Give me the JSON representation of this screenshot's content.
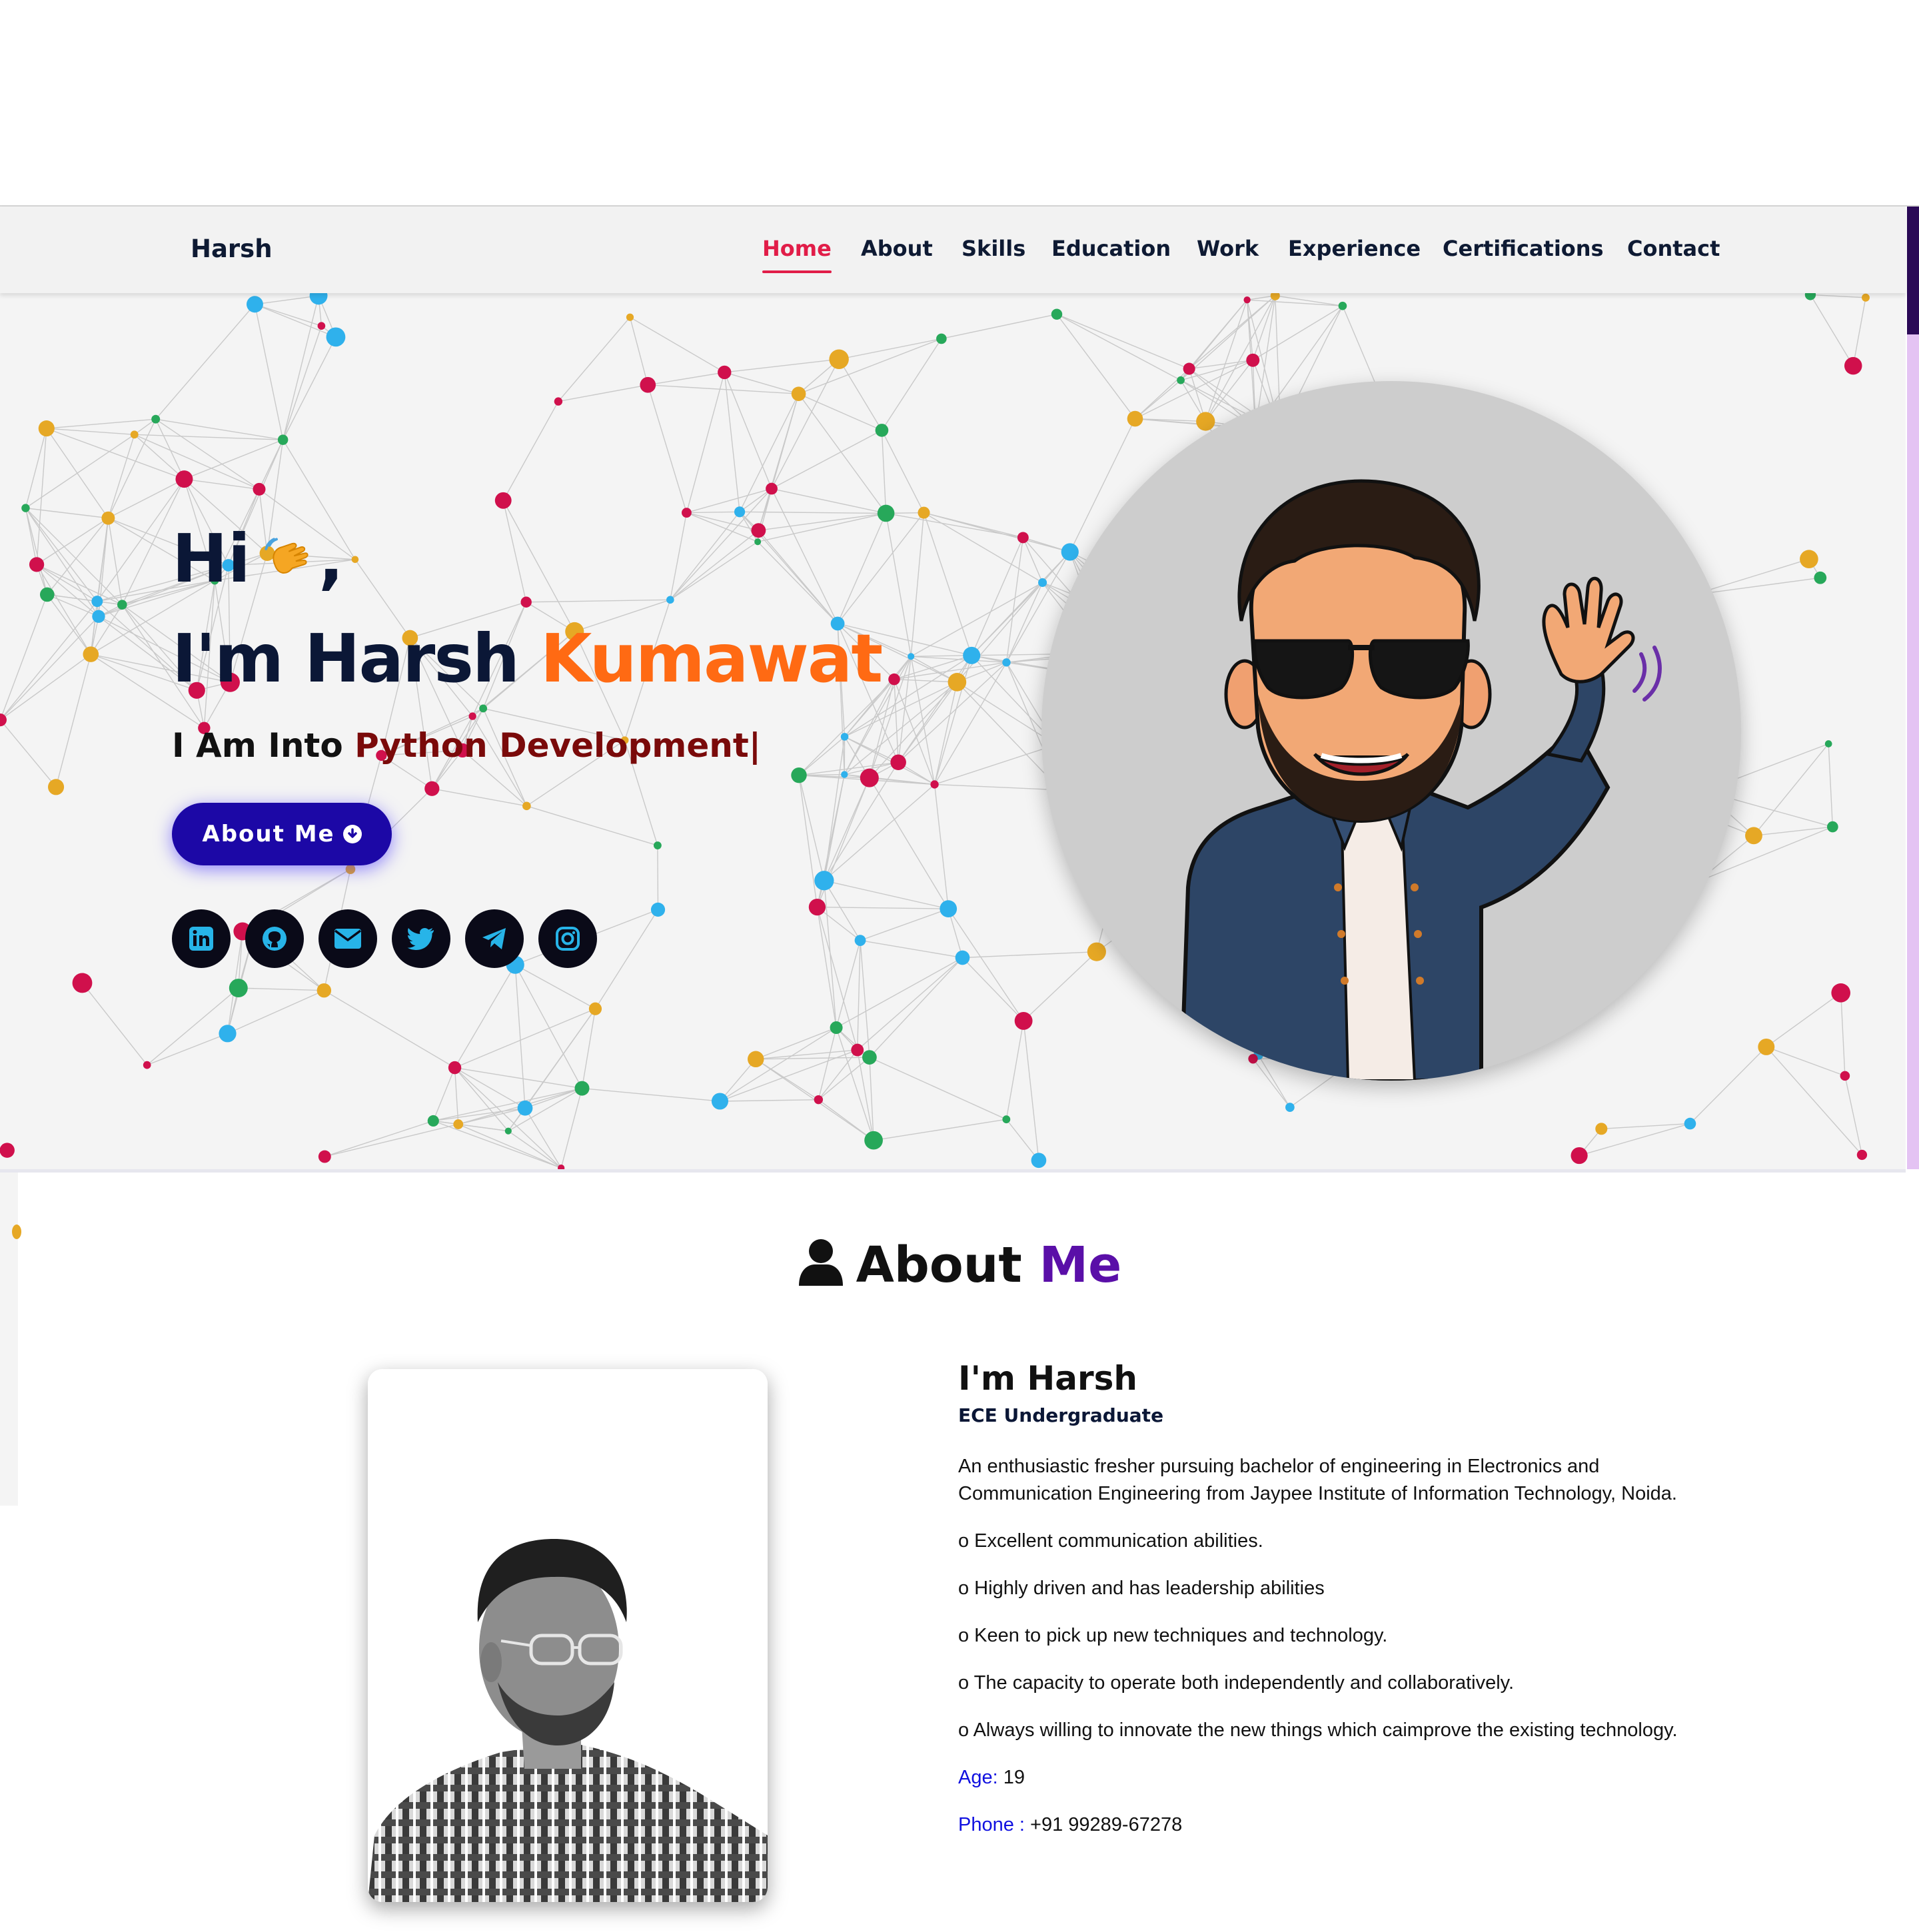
{
  "brand": "Harsh",
  "nav": {
    "items": [
      {
        "label": "Home",
        "active": true
      },
      {
        "label": "About",
        "active": false
      },
      {
        "label": "Skills",
        "active": false
      },
      {
        "label": "Education",
        "active": false
      },
      {
        "label": "Work",
        "active": false
      },
      {
        "label": "Experience",
        "active": false
      },
      {
        "label": "Certifications",
        "active": false
      },
      {
        "label": "Contact",
        "active": false
      }
    ],
    "active_color": "#e11d48"
  },
  "hero": {
    "greeting": "Hi",
    "greeting_suffix": ",",
    "name_prefix": "I'm Harsh ",
    "name_accent": "Kumawat",
    "typing_prefix": "I Am Into ",
    "typing_value": "Python Development|",
    "button_label": "About Me",
    "socials": [
      "linkedin-icon",
      "github-icon",
      "envelope-icon",
      "twitter-icon",
      "telegram-icon",
      "instagram-icon"
    ],
    "colors": {
      "name_accent": "#ff6a13",
      "button": "#1c08a6",
      "typed": "#7a0a0a"
    }
  },
  "about": {
    "heading_main": "About ",
    "heading_accent": "Me",
    "name": "I'm Harsh",
    "role": "ECE Undergraduate",
    "intro": "An enthusiastic fresher pursuing bachelor of engineering in Electronics and Communication Engineering from Jaypee Institute of Information Technology, Noida.",
    "points": [
      "o Excellent communication abilities.",
      "o Highly driven and has leadership abilities",
      "o Keen to pick up new techniques and technology.",
      "o The capacity to operate both independently and collaboratively.",
      "o Always willing to innovate the new things which caimprove the existing technology."
    ],
    "age_label": "Age:",
    "age_value": " 19",
    "phone_label": "Phone :",
    "phone_value": " +91 99289-67278"
  }
}
